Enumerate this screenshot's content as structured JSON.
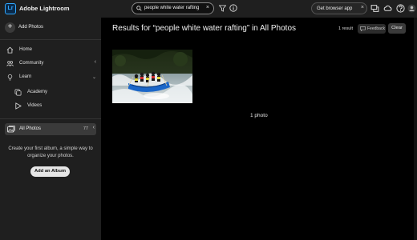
{
  "app": {
    "title": "Adobe Lightroom",
    "logo_text": "Lr"
  },
  "search": {
    "query": "people white water rafting",
    "clear_glyph": "×"
  },
  "header": {
    "get_browser_app": "Get browser app",
    "close_glyph": "×",
    "icons": [
      "filter-icon",
      "info-icon",
      "chat-icon",
      "cloud-icon",
      "help-icon",
      "account-icon"
    ]
  },
  "sidebar": {
    "add_photos": "Add Photos",
    "nav": [
      {
        "label": "Home",
        "icon": "home-icon"
      },
      {
        "label": "Community",
        "icon": "community-icon"
      },
      {
        "label": "Learn",
        "icon": "learn-icon"
      }
    ],
    "learn_sub": [
      {
        "label": "Academy",
        "icon": "academy-icon"
      },
      {
        "label": "Videos",
        "icon": "play-icon"
      }
    ],
    "all_photos": {
      "label": "All Photos",
      "count": "77"
    },
    "album_hint": "Create your first album, a simple way to organize your photos.",
    "add_album": "Add an Album"
  },
  "main": {
    "results_title": "Results for “people white water rafting” in All Photos",
    "result_count": "1 result",
    "feedback": "Feedback",
    "clear": "Clear",
    "photo_count": "1 photo"
  },
  "colors": {
    "accent": "#31a8ff",
    "main_bg": "#000000",
    "sidebar_bg": "#1f1f1f"
  }
}
